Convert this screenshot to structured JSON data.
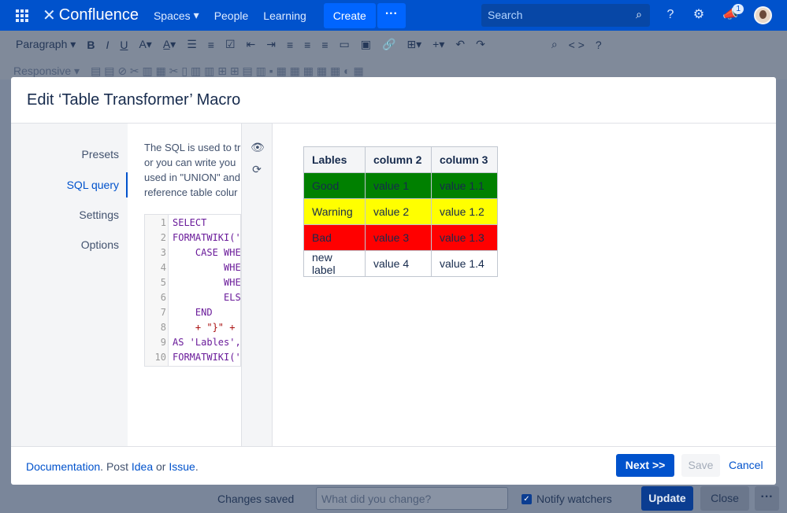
{
  "nav": {
    "logo": "Confluence",
    "links": [
      "Spaces",
      "People",
      "Learning"
    ],
    "create": "Create",
    "search_placeholder": "Search",
    "notif_count": "1"
  },
  "toolbar": {
    "paragraph": "Paragraph",
    "responsive": "Responsive",
    "source": "< >"
  },
  "modal": {
    "title": "Edit ‘Table Transformer’ Macro",
    "side": [
      "Presets",
      "SQL query",
      "Settings",
      "Options"
    ],
    "active_side": "SQL query",
    "help_lines": [
      "The SQL is used to tr",
      "or you can write you",
      "used in \"UNION\" and",
      "reference table colur"
    ],
    "code": [
      {
        "n": "1",
        "t": "SELECT"
      },
      {
        "n": "2",
        "t": "FORMATWIKI('"
      },
      {
        "n": "3",
        "t": "    CASE WHE"
      },
      {
        "n": "4",
        "t": "         WHE"
      },
      {
        "n": "5",
        "t": "         WHE"
      },
      {
        "n": "6",
        "t": "         ELS"
      },
      {
        "n": "7",
        "t": "    END"
      },
      {
        "n": "8",
        "t": "    + \"}\" +"
      },
      {
        "n": "9",
        "t": "AS 'Lables',"
      },
      {
        "n": "10",
        "t": "FORMATWIKI('"
      }
    ],
    "table": {
      "headers": [
        "Lables",
        "column 2",
        "column 3"
      ],
      "rows": [
        {
          "cells": [
            "Good",
            "value 1",
            "value 1.1"
          ],
          "color": "#008000"
        },
        {
          "cells": [
            "Warning",
            "value 2",
            "value 1.2"
          ],
          "color": "#ffff00"
        },
        {
          "cells": [
            "Bad",
            "value 3",
            "value 1.3"
          ],
          "color": "#ff0000"
        },
        {
          "cells": [
            "new label",
            "value 4",
            "value 1.4"
          ],
          "color": "#ffffff"
        }
      ]
    },
    "footer": {
      "documentation": "Documentation",
      "post": ". Post ",
      "idea": "Idea",
      "or": " or ",
      "issue": "Issue",
      "end": "."
    },
    "next": "Next >>",
    "save": "Save",
    "cancel": "Cancel"
  },
  "bottom": {
    "saved": "Changes saved",
    "change_placeholder": "What did you change?",
    "notify": "Notify watchers",
    "update": "Update",
    "close": "Close"
  }
}
